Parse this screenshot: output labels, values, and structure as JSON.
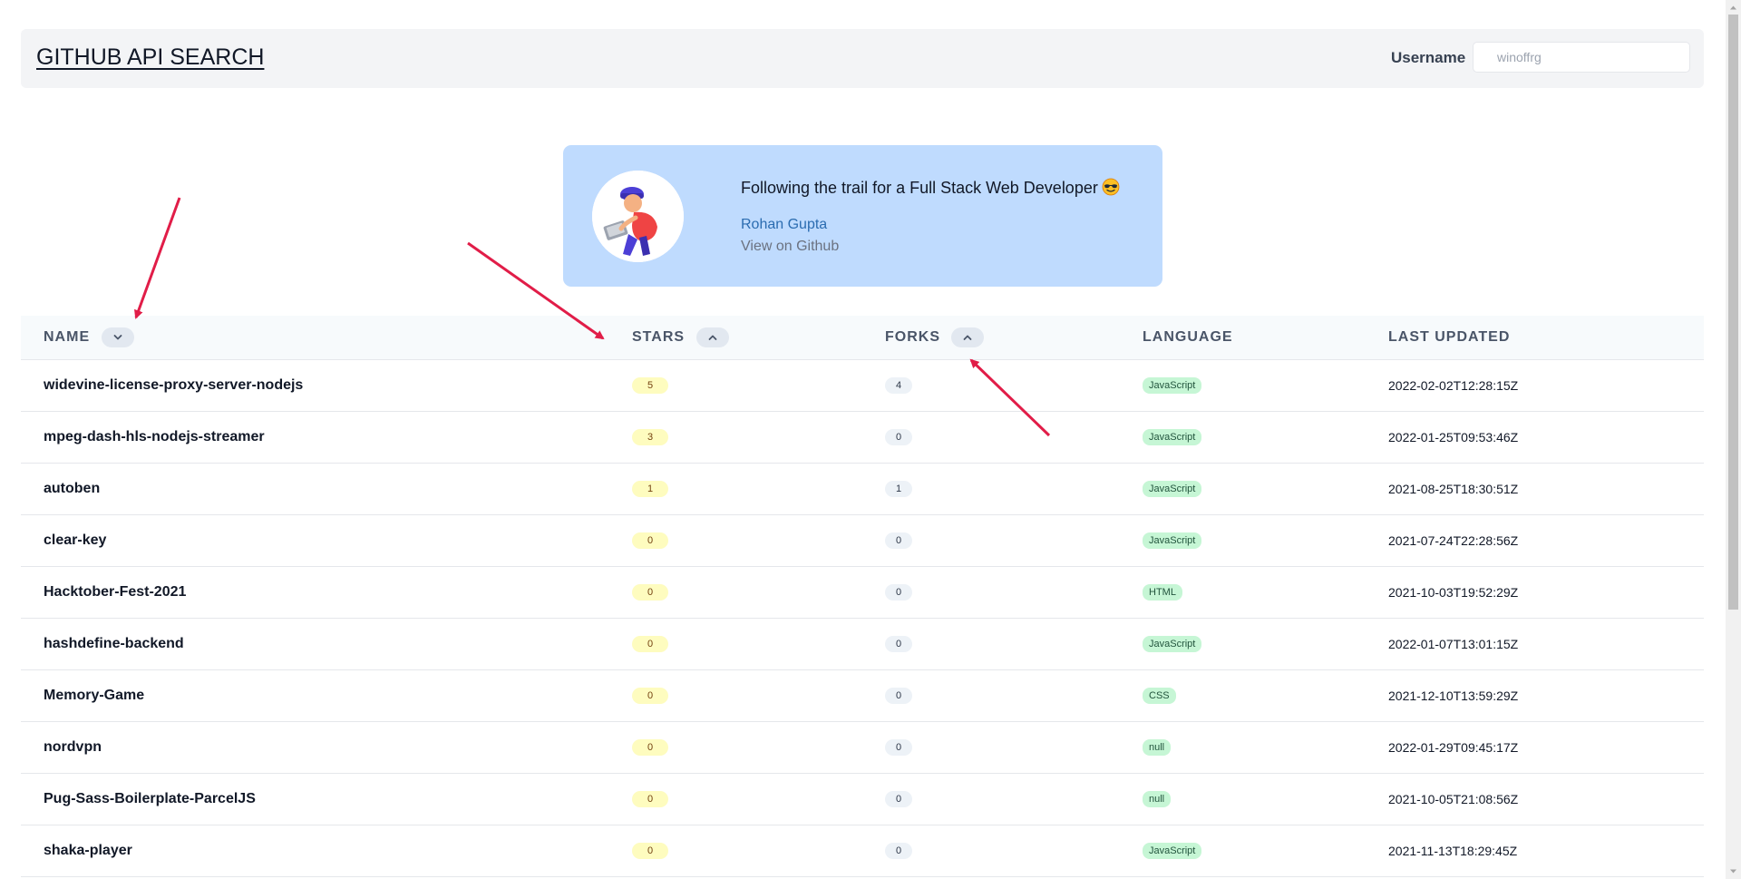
{
  "header": {
    "title": "GITHUB API SEARCH",
    "username_label": "Username",
    "username_placeholder": "winoffrg"
  },
  "profile": {
    "bio": "Following the trail for a Full Stack Web Developer",
    "bio_emoji": "smiling-face-with-sunglasses-icon",
    "name": "Rohan Gupta",
    "link_text": "View on Github"
  },
  "table": {
    "columns": [
      {
        "label": "NAME",
        "sort": "down"
      },
      {
        "label": "STARS",
        "sort": "up"
      },
      {
        "label": "FORKS",
        "sort": "up"
      },
      {
        "label": "LANGUAGE"
      },
      {
        "label": "LAST UPDATED"
      }
    ],
    "rows": [
      {
        "name": "widevine-license-proxy-server-nodejs",
        "stars": "5",
        "forks": "4",
        "language": "JavaScript",
        "updated": "2022-02-02T12:28:15Z"
      },
      {
        "name": "mpeg-dash-hls-nodejs-streamer",
        "stars": "3",
        "forks": "0",
        "language": "JavaScript",
        "updated": "2022-01-25T09:53:46Z"
      },
      {
        "name": "autoben",
        "stars": "1",
        "forks": "1",
        "language": "JavaScript",
        "updated": "2021-08-25T18:30:51Z"
      },
      {
        "name": "clear-key",
        "stars": "0",
        "forks": "0",
        "language": "JavaScript",
        "updated": "2021-07-24T22:28:56Z"
      },
      {
        "name": "Hacktober-Fest-2021",
        "stars": "0",
        "forks": "0",
        "language": "HTML",
        "updated": "2021-10-03T19:52:29Z"
      },
      {
        "name": "hashdefine-backend",
        "stars": "0",
        "forks": "0",
        "language": "JavaScript",
        "updated": "2022-01-07T13:01:15Z"
      },
      {
        "name": "Memory-Game",
        "stars": "0",
        "forks": "0",
        "language": "CSS",
        "updated": "2021-12-10T13:59:29Z"
      },
      {
        "name": "nordvpn",
        "stars": "0",
        "forks": "0",
        "language": "null",
        "updated": "2022-01-29T09:45:17Z"
      },
      {
        "name": "Pug-Sass-Boilerplate-ParcelJS",
        "stars": "0",
        "forks": "0",
        "language": "null",
        "updated": "2021-10-05T21:08:56Z"
      },
      {
        "name": "shaka-player",
        "stars": "0",
        "forks": "0",
        "language": "JavaScript",
        "updated": "2021-11-13T18:29:45Z"
      }
    ]
  },
  "colors": {
    "header_bg": "#f3f4f6",
    "card_bg": "#bfdbfe",
    "link": "#2b6cb0",
    "stars_badge": "#fefcbf",
    "forks_badge": "#edf2f7",
    "language_badge": "#c6f6d5",
    "annotation_arrow": "#e11d48"
  }
}
